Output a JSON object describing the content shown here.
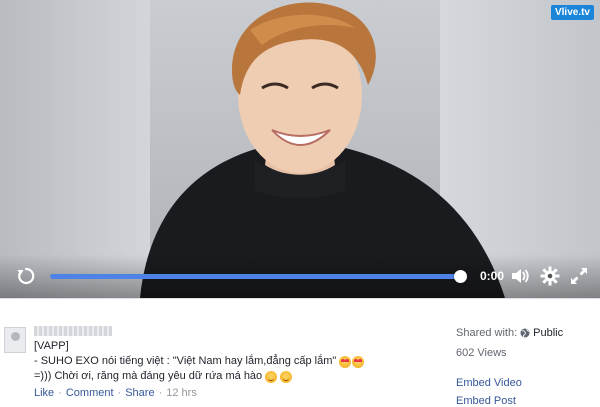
{
  "video": {
    "watermark": "Vlive.tv",
    "progress": 1.0,
    "time": "0:00",
    "icons": [
      "replay-icon",
      "volume-icon",
      "settings-icon",
      "fullscreen-icon"
    ]
  },
  "post": {
    "tag": "[VAPP]",
    "line2": "- SUHO EXO nói tiếng việt : \"Việt Nam hay lắm,đẳng cấp lắm\"",
    "line3": "=))) Chời ơi, răng mà đáng yêu dữ rứa má hào",
    "actions": {
      "like": "Like",
      "comment": "Comment",
      "share": "Share",
      "separator": "·",
      "time_ago": "12 hrs"
    }
  },
  "sidebar": {
    "shared_label": "Shared with:",
    "shared_value": "Public",
    "views": "602 Views",
    "embed_video": "Embed Video",
    "embed_post": "Embed Post"
  },
  "colors": {
    "accent": "#4f82e6",
    "link": "#365899",
    "watermark_bg": "#1b86d9"
  }
}
